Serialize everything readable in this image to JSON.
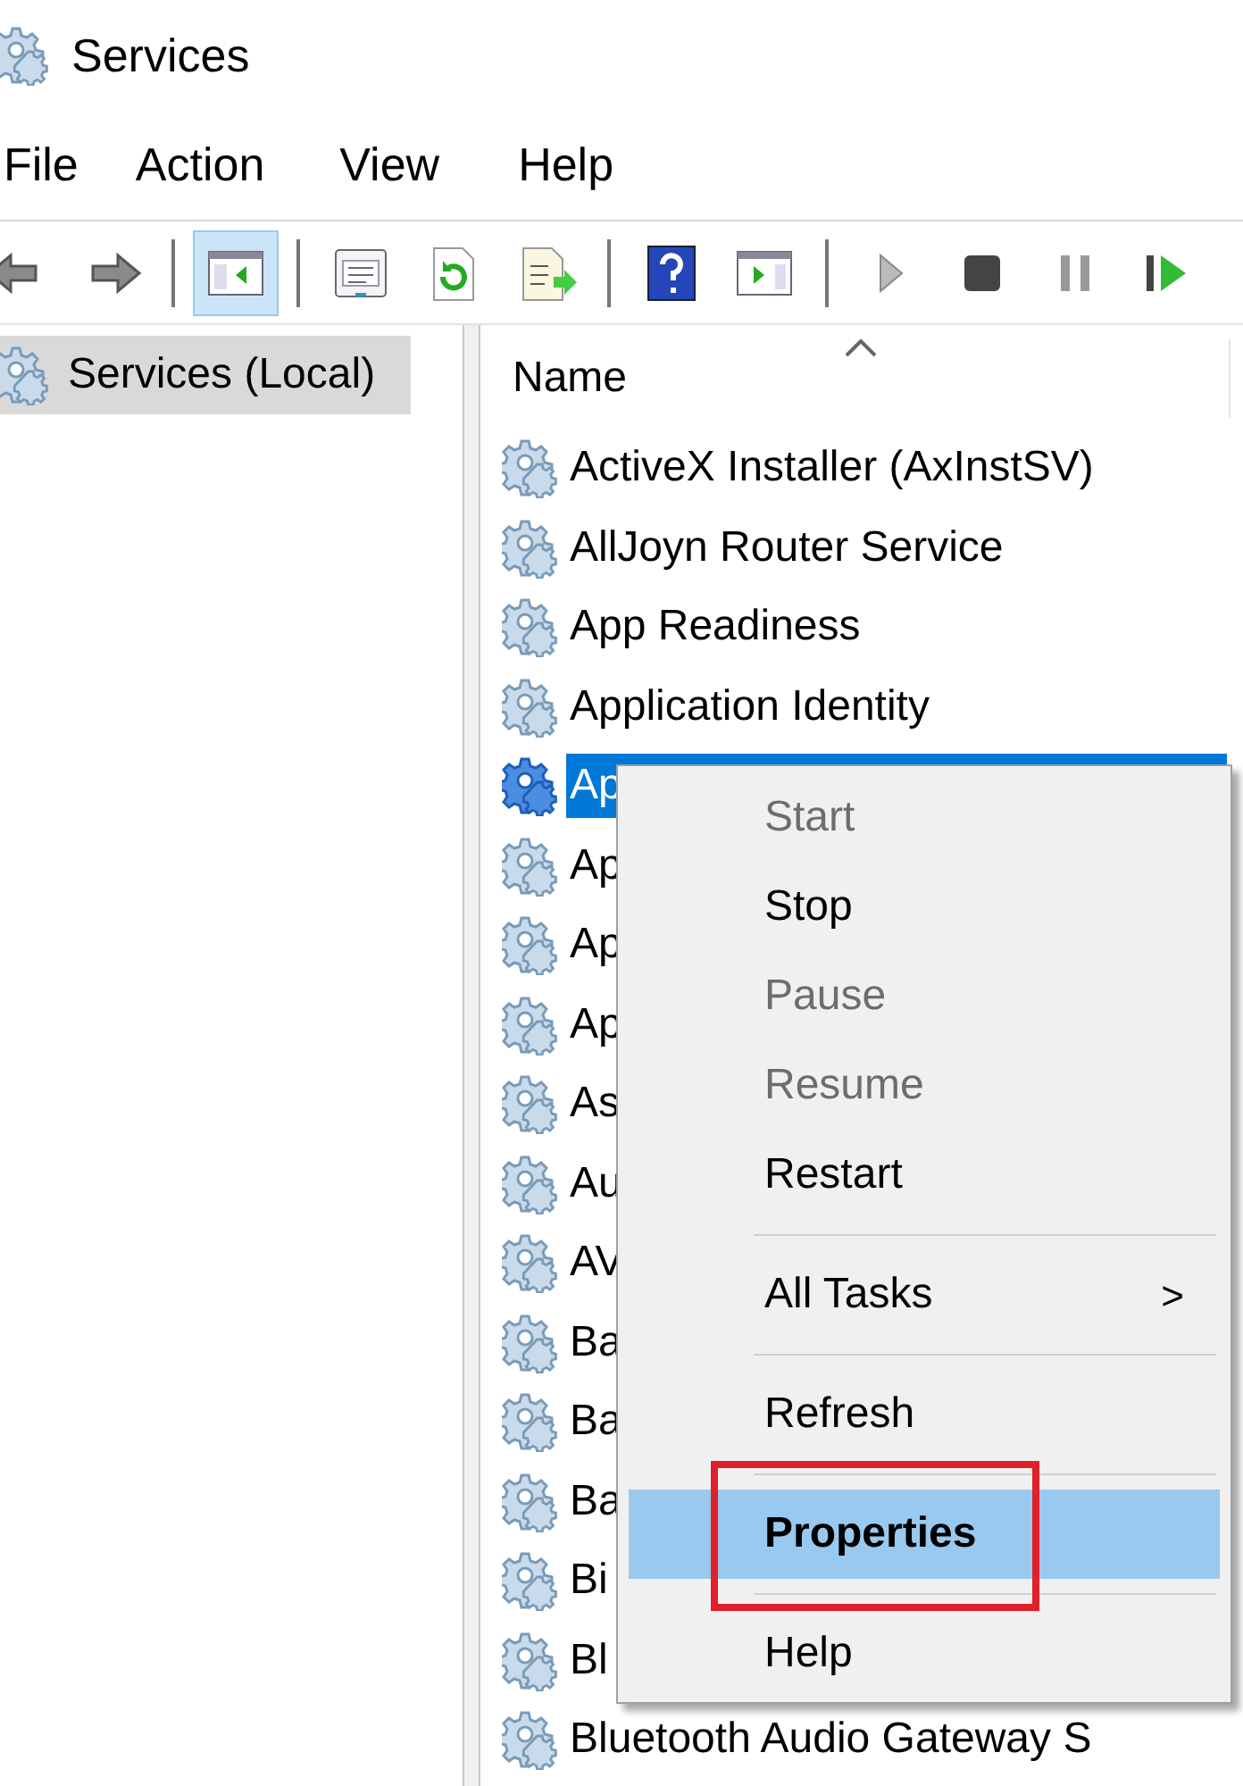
{
  "window": {
    "title": "Services"
  },
  "menu_bar": [
    "File",
    "Action",
    "View",
    "Help"
  ],
  "toolbar": [
    {
      "kind": "back",
      "selected": false
    },
    {
      "kind": "forward",
      "selected": false
    },
    {
      "kind": "separator"
    },
    {
      "kind": "tree",
      "selected": true
    },
    {
      "kind": "separator"
    },
    {
      "kind": "properties",
      "selected": false
    },
    {
      "kind": "refresh",
      "selected": false
    },
    {
      "kind": "export",
      "selected": false
    },
    {
      "kind": "separator"
    },
    {
      "kind": "help",
      "selected": false
    },
    {
      "kind": "actionpane",
      "selected": false
    },
    {
      "kind": "separator"
    },
    {
      "kind": "play",
      "selected": false
    },
    {
      "kind": "stop",
      "selected": false
    },
    {
      "kind": "pause",
      "selected": false
    },
    {
      "kind": "resume",
      "selected": false
    }
  ],
  "tree": [
    {
      "label": "Services (Local)",
      "selected": true
    }
  ],
  "table": {
    "columns": [
      "Name"
    ],
    "rows": [
      {
        "name": "ActiveX Installer (AxInstSV)",
        "selected": false
      },
      {
        "name": "AllJoyn Router Service",
        "selected": false
      },
      {
        "name": "App Readiness",
        "selected": false
      },
      {
        "name": "Application Identity",
        "selected": false
      },
      {
        "name": "Ap",
        "selected": true
      },
      {
        "name": "Ap",
        "selected": false
      },
      {
        "name": "Ap",
        "selected": false
      },
      {
        "name": "Ap",
        "selected": false
      },
      {
        "name": "As",
        "selected": false
      },
      {
        "name": "Au",
        "selected": false
      },
      {
        "name": "AV",
        "selected": false
      },
      {
        "name": "Ba",
        "selected": false
      },
      {
        "name": "Ba",
        "selected": false
      },
      {
        "name": "Ba",
        "selected": false
      },
      {
        "name": "Bi",
        "selected": false
      },
      {
        "name": "Bl",
        "selected": false
      },
      {
        "name": "Bluetooth Audio Gateway S",
        "selected": false
      }
    ]
  },
  "context_menu": [
    {
      "kind": "item",
      "label": "Start",
      "disabled": true,
      "selected": false
    },
    {
      "kind": "item",
      "label": "Stop",
      "disabled": false,
      "selected": false
    },
    {
      "kind": "item",
      "label": "Pause",
      "disabled": true,
      "selected": false
    },
    {
      "kind": "item",
      "label": "Resume",
      "disabled": true,
      "selected": false
    },
    {
      "kind": "item",
      "label": "Restart",
      "disabled": false,
      "selected": false
    },
    {
      "kind": "separator"
    },
    {
      "kind": "item",
      "label": "All Tasks",
      "disabled": false,
      "selected": false,
      "submenu": true,
      "submenu_arrow": ">"
    },
    {
      "kind": "separator"
    },
    {
      "kind": "item",
      "label": "Refresh",
      "disabled": false,
      "selected": false
    },
    {
      "kind": "separator"
    },
    {
      "kind": "item",
      "label": "Properties",
      "disabled": false,
      "selected": true,
      "annotated": true
    },
    {
      "kind": "separator"
    },
    {
      "kind": "item",
      "label": "Help",
      "disabled": false,
      "selected": false
    }
  ]
}
